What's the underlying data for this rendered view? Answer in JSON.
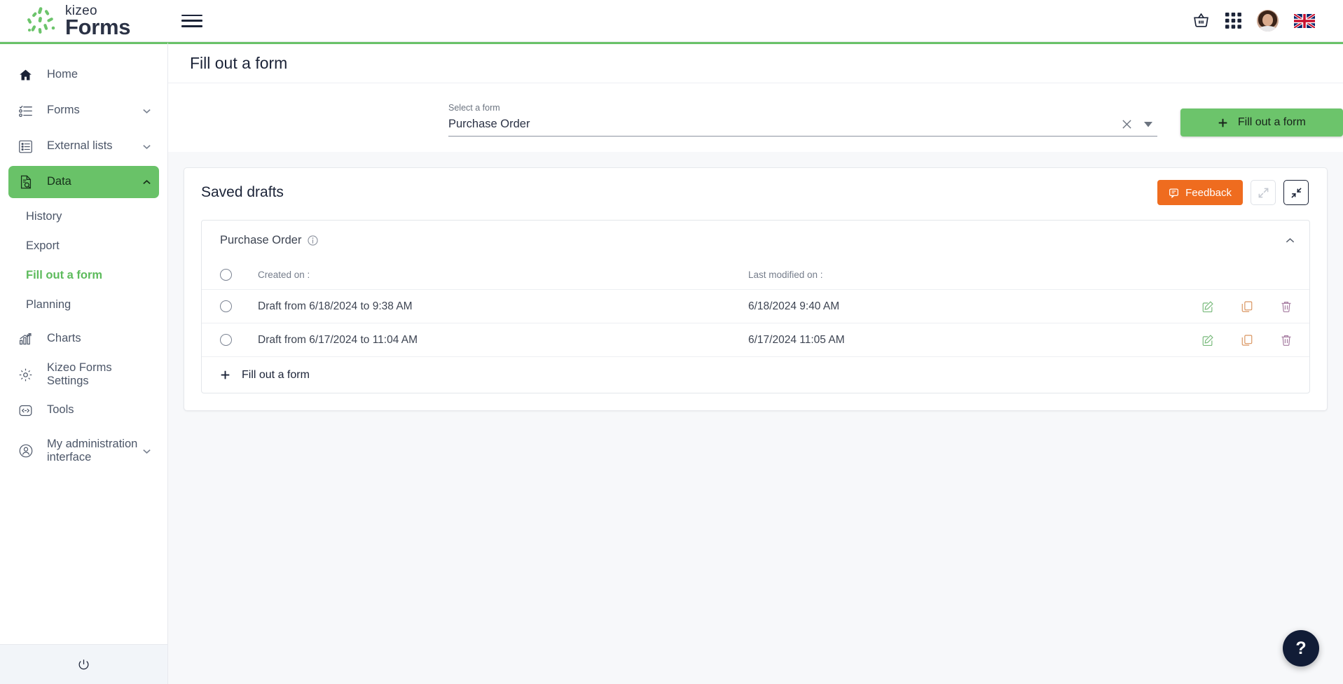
{
  "brand": {
    "name_top": "kizeo",
    "name_bottom": "Forms",
    "green": "#69c268",
    "dark": "#2b3245"
  },
  "header": {
    "menu_toggle": "menu-toggle",
    "icons": [
      {
        "name": "basket-icon",
        "label": "Basket"
      },
      {
        "name": "apps-grid-icon",
        "label": "Applications"
      },
      {
        "name": "user-avatar",
        "label": "Account"
      },
      {
        "name": "language-flag-uk",
        "label": "English"
      }
    ]
  },
  "sidebar": {
    "items": [
      {
        "label": "Home",
        "icon": "home-icon",
        "expandable": false,
        "active": false
      },
      {
        "label": "Forms",
        "icon": "forms-icon",
        "expandable": true,
        "active": false
      },
      {
        "label": "External lists",
        "icon": "external-lists-icon",
        "expandable": true,
        "active": false
      },
      {
        "label": "Data",
        "icon": "data-icon",
        "expandable": true,
        "active": true
      }
    ],
    "data_subitems": [
      {
        "label": "History",
        "current": false
      },
      {
        "label": "Export",
        "current": false
      },
      {
        "label": "Fill out a form",
        "current": true
      },
      {
        "label": "Planning",
        "current": false
      }
    ],
    "items_after": [
      {
        "label": "Charts",
        "icon": "charts-icon",
        "expandable": false,
        "active": false
      },
      {
        "label": "Kizeo Forms Settings",
        "icon": "gear-icon",
        "expandable": false,
        "active": false
      },
      {
        "label": "Tools",
        "icon": "tools-icon",
        "expandable": false,
        "active": false
      },
      {
        "label": "My administration interface",
        "icon": "admin-user-icon",
        "expandable": true,
        "active": false
      }
    ],
    "logout_icon": "power-icon"
  },
  "page": {
    "title": "Fill out a form"
  },
  "selector": {
    "label": "Select a form",
    "value": "Purchase Order",
    "clear_icon": "close-icon",
    "dropdown_icon": "chevron-down-icon",
    "primary_button": "Fill out a form",
    "primary_button_icon": "plus-icon"
  },
  "card": {
    "title": "Saved drafts",
    "feedback_label": "Feedback",
    "feedback_icon": "feedback-icon",
    "feedback_color": "#ef6c1f",
    "expand_button": "expand-icon",
    "collapse_button": "collapse-icon"
  },
  "panel": {
    "title": "Purchase Order",
    "info_icon": "info-icon",
    "collapse_icon": "chevron-up-icon",
    "columns": {
      "created": "Created on :",
      "modified": "Last modified on :"
    },
    "rows": [
      {
        "created": "Draft from 6/18/2024 to 9:38 AM",
        "modified": "6/18/2024 9:40 AM",
        "actions": [
          "edit-icon",
          "duplicate-icon",
          "delete-icon"
        ]
      },
      {
        "created": "Draft from 6/17/2024 to 11:04 AM",
        "modified": "6/17/2024 11:05 AM",
        "actions": [
          "edit-icon",
          "duplicate-icon",
          "delete-icon"
        ]
      }
    ],
    "add_label": "Fill out a form",
    "add_icon": "plus-icon",
    "action_colors": {
      "edit": "#77b97a",
      "duplicate": "#d9945f",
      "delete": "#a4799f"
    }
  },
  "help": {
    "label": "?"
  }
}
